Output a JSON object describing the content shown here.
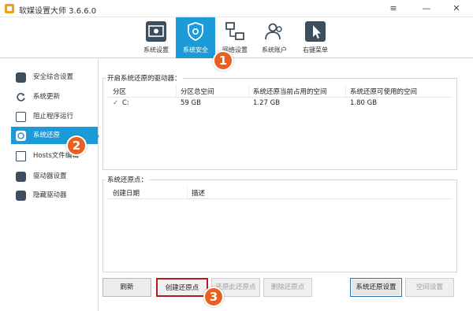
{
  "app": {
    "title": "软媒设置大师 3.6.6.0"
  },
  "window_controls": {
    "menu": "≡",
    "minimize": "—",
    "close": "✕"
  },
  "toolbar": {
    "items": [
      {
        "label": "系统设置",
        "icon": "system-settings-icon"
      },
      {
        "label": "系统安全",
        "icon": "shield-icon",
        "active": true
      },
      {
        "label": "网络设置",
        "icon": "network-icon"
      },
      {
        "label": "系统账户",
        "icon": "users-icon"
      },
      {
        "label": "右键菜单",
        "icon": "cursor-icon"
      }
    ]
  },
  "sidebar": {
    "items": [
      {
        "label": "安全综合设置",
        "icon": "shield-check-icon"
      },
      {
        "label": "系统更新",
        "icon": "refresh-icon"
      },
      {
        "label": "阻止程序运行",
        "icon": "block-icon"
      },
      {
        "label": "系统还原",
        "icon": "restore-icon",
        "active": true
      },
      {
        "label": "Hosts文件编辑",
        "icon": "hosts-icon"
      },
      {
        "label": "驱动器设置",
        "icon": "drive-icon"
      },
      {
        "label": "隐藏驱动器",
        "icon": "hidden-drive-icon"
      }
    ]
  },
  "drives_group": {
    "label": "开启系统还原的驱动器：",
    "headers": [
      "分区",
      "分区总空间",
      "系统还原当前占用的空间",
      "系统还原可使用的空间"
    ],
    "rows": [
      {
        "partition": "C:",
        "checked": true,
        "total": "59 GB",
        "used": "1.27 GB",
        "available": "1.80 GB"
      }
    ]
  },
  "points_group": {
    "label": "系统还原点：",
    "headers": [
      "创建日期",
      "描述"
    ]
  },
  "buttons": {
    "refresh": "刷新",
    "create": "创建还原点",
    "restore": "还原此还原点",
    "delete": "删除还原点",
    "settings": "系统还原设置",
    "space": "空间设置"
  },
  "markers": [
    "1",
    "2",
    "3"
  ],
  "colors": {
    "accent": "#1d9bd8",
    "marker": "#e8601f",
    "highlight_border": "#b71c1c"
  }
}
